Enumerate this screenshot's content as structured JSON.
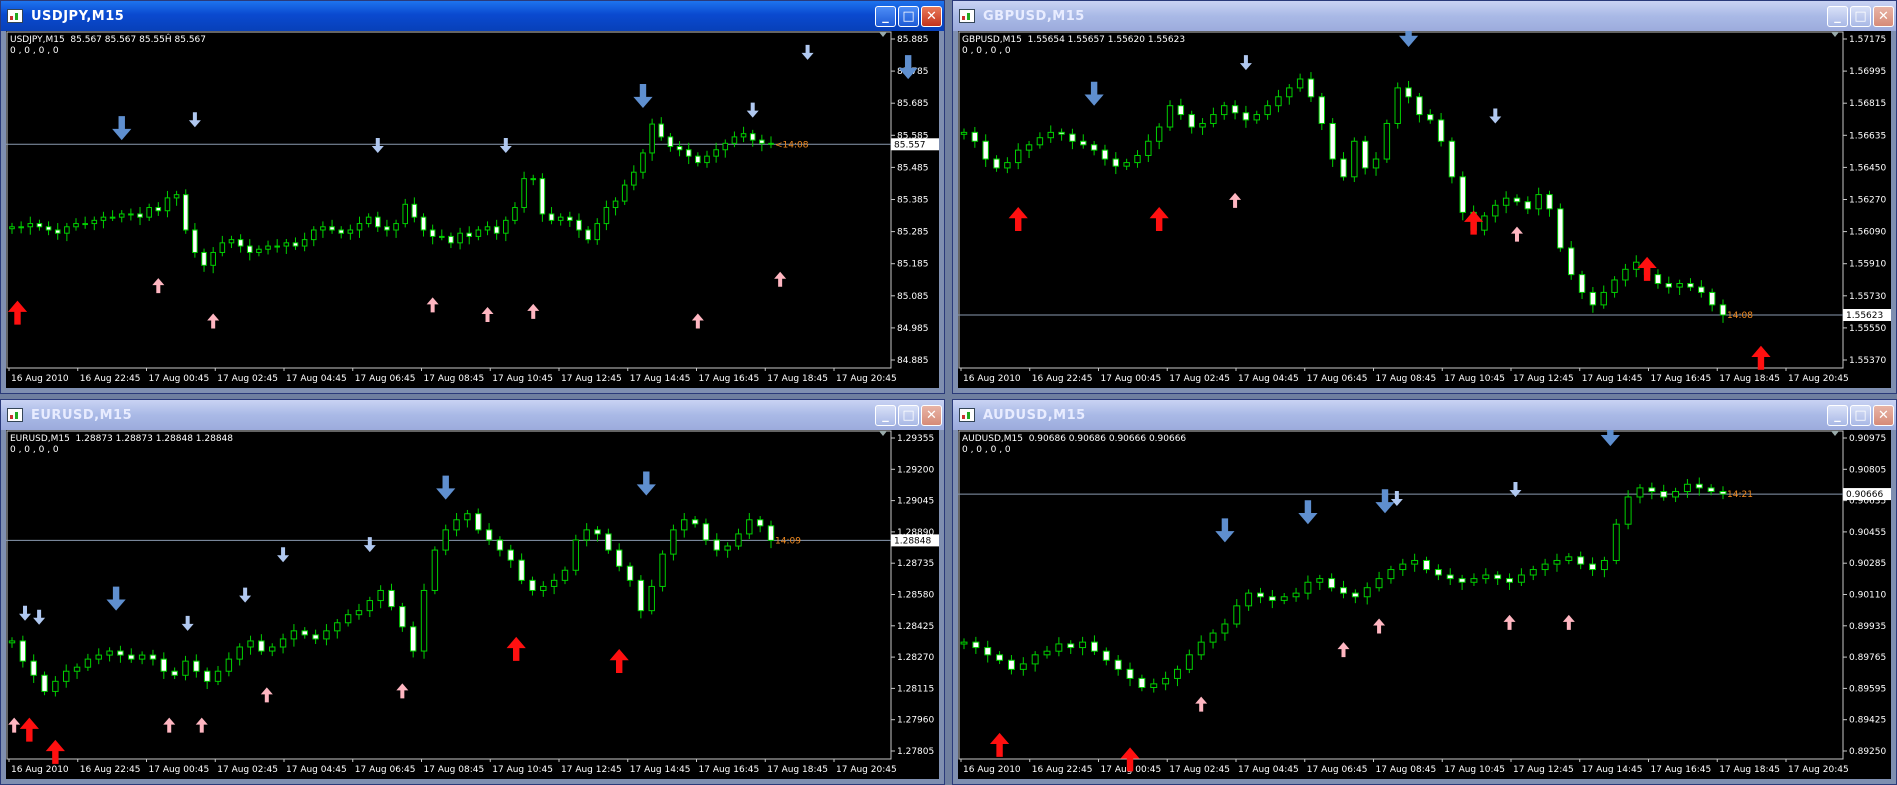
{
  "windows": [
    {
      "id": "usdjpy",
      "title": "USDJPY,M15",
      "active": true,
      "info_line": "USDJPY,M15  85.567 85.567 85.55Ĥ 85.567",
      "indicator_line": "0 , 0 , 0 , 0",
      "price_label": "85.557",
      "timer_label": "<14:08",
      "y_ticks": [
        "85.885",
        "85.785",
        "85.685",
        "85.585",
        "85.485",
        "85.385",
        "85.285",
        "85.185",
        "85.085",
        "84.985",
        "84.885"
      ],
      "x_ticks": [
        "16 Aug 2010",
        "16 Aug 22:45",
        "17 Aug 00:45",
        "17 Aug 02:45",
        "17 Aug 04:45",
        "17 Aug 06:45",
        "17 Aug 08:45",
        "17 Aug 10:45",
        "17 Aug 12:45",
        "17 Aug 14:45",
        "17 Aug 16:45",
        "17 Aug 18:45",
        "17 Aug 20:45"
      ],
      "ylim": [
        84.885,
        85.885
      ],
      "current_price": 85.557,
      "closes": [
        85.3,
        85.3,
        85.31,
        85.3,
        85.29,
        85.28,
        85.3,
        85.31,
        85.31,
        85.32,
        85.33,
        85.33,
        85.34,
        85.34,
        85.33,
        85.36,
        85.35,
        85.39,
        85.4,
        85.29,
        85.22,
        85.18,
        85.22,
        85.25,
        85.26,
        85.24,
        85.22,
        85.23,
        85.24,
        85.24,
        85.25,
        85.24,
        85.26,
        85.29,
        85.3,
        85.29,
        85.28,
        85.29,
        85.31,
        85.33,
        85.3,
        85.29,
        85.31,
        85.37,
        85.33,
        85.29,
        85.27,
        85.27,
        85.25,
        85.28,
        85.27,
        85.29,
        85.3,
        85.28,
        85.32,
        85.36,
        85.45,
        85.45,
        85.34,
        85.32,
        85.33,
        85.32,
        85.29,
        85.26,
        85.31,
        85.36,
        85.38,
        85.43,
        85.47,
        85.53,
        85.62,
        85.58,
        85.55,
        85.54,
        85.52,
        85.5,
        85.52,
        85.54,
        85.56,
        85.58,
        85.59,
        85.57,
        85.56,
        85.557
      ],
      "up_big": [
        [
          0.6,
          85.07
        ]
      ],
      "up_small": [
        [
          16,
          85.14
        ],
        [
          22,
          85.03
        ],
        [
          46,
          85.08
        ],
        [
          52,
          85.05
        ],
        [
          57,
          85.06
        ],
        [
          75,
          85.03
        ],
        [
          84,
          85.16
        ]
      ],
      "down_big": [
        [
          12,
          85.57
        ],
        [
          69,
          85.67
        ],
        [
          98,
          85.76
        ]
      ],
      "down_small": [
        [
          20,
          85.61
        ],
        [
          40,
          85.53
        ],
        [
          54,
          85.53
        ],
        [
          81,
          85.64
        ],
        [
          87,
          85.82
        ]
      ]
    },
    {
      "id": "gbpusd",
      "title": "GBPUSD,M15",
      "active": false,
      "info_line": "GBPUSD,M15  1.55654 1.55657 1.55620 1.55623",
      "indicator_line": "0 , 0 , 0 , 0",
      "price_label": "1.55623",
      "timer_label": "14:08",
      "y_ticks": [
        "1.57175",
        "1.56995",
        "1.56815",
        "1.56635",
        "1.56450",
        "1.56270",
        "1.56090",
        "1.55910",
        "1.55730",
        "1.55550",
        "1.55370"
      ],
      "x_ticks": [
        "16 Aug 2010",
        "16 Aug 22:45",
        "17 Aug 00:45",
        "17 Aug 02:45",
        "17 Aug 04:45",
        "17 Aug 06:45",
        "17 Aug 08:45",
        "17 Aug 10:45",
        "17 Aug 12:45",
        "17 Aug 14:45",
        "17 Aug 16:45",
        "17 Aug 18:45",
        "17 Aug 20:45"
      ],
      "ylim": [
        1.5537,
        1.57175
      ],
      "current_price": 1.55623,
      "closes": [
        1.5665,
        1.566,
        1.565,
        1.5645,
        1.5648,
        1.5655,
        1.5658,
        1.5662,
        1.5665,
        1.5664,
        1.566,
        1.5658,
        1.5655,
        1.565,
        1.5646,
        1.5648,
        1.5652,
        1.566,
        1.5668,
        1.568,
        1.5675,
        1.5668,
        1.567,
        1.5675,
        1.568,
        1.5676,
        1.5672,
        1.5675,
        1.568,
        1.5685,
        1.569,
        1.5695,
        1.5685,
        1.567,
        1.565,
        1.564,
        1.566,
        1.5645,
        1.565,
        1.567,
        1.569,
        1.5685,
        1.5675,
        1.5672,
        1.566,
        1.564,
        1.562,
        1.561,
        1.5618,
        1.5624,
        1.5628,
        1.5626,
        1.5622,
        1.563,
        1.5622,
        1.56,
        1.5585,
        1.5575,
        1.5568,
        1.5575,
        1.5582,
        1.5588,
        1.5592,
        1.5585,
        1.558,
        1.5578,
        1.558,
        1.5578,
        1.5575,
        1.5568,
        1.55623
      ],
      "up_big": [
        [
          5,
          1.5623
        ],
        [
          18,
          1.5623
        ],
        [
          47,
          1.5621
        ],
        [
          63,
          1.5595
        ],
        [
          73.5,
          1.5545
        ]
      ],
      "up_small": [
        [
          25,
          1.5631
        ],
        [
          51,
          1.5612
        ]
      ],
      "down_big": [
        [
          12,
          1.568
        ],
        [
          41,
          1.5713
        ]
      ],
      "down_small": [
        [
          26,
          1.57
        ],
        [
          49,
          1.567
        ]
      ]
    },
    {
      "id": "eurusd",
      "title": "EURUSD,M15",
      "active": false,
      "info_line": "EURUSD,M15  1.28873 1.28873 1.28848 1.28848",
      "indicator_line": "0 , 0 , 0 , 0",
      "price_label": "1.28848",
      "timer_label": "14:09",
      "y_ticks": [
        "1.29355",
        "1.29200",
        "1.29045",
        "1.28890",
        "1.28735",
        "1.28580",
        "1.28425",
        "1.28270",
        "1.28115",
        "1.27960",
        "1.27805"
      ],
      "x_ticks": [
        "16 Aug 2010",
        "16 Aug 22:45",
        "17 Aug 00:45",
        "17 Aug 02:45",
        "17 Aug 04:45",
        "17 Aug 06:45",
        "17 Aug 08:45",
        "17 Aug 10:45",
        "17 Aug 12:45",
        "17 Aug 14:45",
        "17 Aug 16:45",
        "17 Aug 18:45",
        "17 Aug 20:45"
      ],
      "ylim": [
        1.27805,
        1.29355
      ],
      "current_price": 1.28848,
      "closes": [
        1.2835,
        1.2825,
        1.2818,
        1.281,
        1.2815,
        1.282,
        1.2822,
        1.2826,
        1.2828,
        1.283,
        1.2828,
        1.2826,
        1.2828,
        1.2826,
        1.282,
        1.2818,
        1.2825,
        1.282,
        1.2815,
        1.282,
        1.2826,
        1.2832,
        1.2835,
        1.283,
        1.2832,
        1.2836,
        1.284,
        1.2838,
        1.2836,
        1.284,
        1.2844,
        1.2848,
        1.285,
        1.2855,
        1.286,
        1.2852,
        1.2842,
        1.283,
        1.286,
        1.288,
        1.289,
        1.2895,
        1.2898,
        1.289,
        1.2885,
        1.288,
        1.2875,
        1.2865,
        1.286,
        1.2862,
        1.2865,
        1.287,
        1.2885,
        1.289,
        1.2888,
        1.288,
        1.2872,
        1.2865,
        1.285,
        1.2862,
        1.2878,
        1.289,
        1.2895,
        1.2893,
        1.2885,
        1.288,
        1.2882,
        1.2888,
        1.2895,
        1.2892,
        1.28848
      ],
      "up_big": [
        [
          1.6,
          1.2797
        ],
        [
          4,
          1.2786
        ],
        [
          46.5,
          1.2837
        ],
        [
          56,
          1.2831
        ]
      ],
      "up_small": [
        [
          0.2,
          1.2797
        ],
        [
          14.5,
          1.2797
        ],
        [
          17.5,
          1.2797
        ],
        [
          23.5,
          1.2812
        ],
        [
          36,
          1.2814
        ]
      ],
      "down_big": [
        [
          9.6,
          1.285
        ],
        [
          40,
          1.2905
        ],
        [
          58.5,
          1.2907
        ]
      ],
      "down_small": [
        [
          1.2,
          1.2845
        ],
        [
          2.5,
          1.2843
        ],
        [
          16.2,
          1.284
        ],
        [
          21.5,
          1.2854
        ],
        [
          25,
          1.2874
        ],
        [
          33,
          1.2879
        ]
      ]
    },
    {
      "id": "audusd",
      "title": "AUDUSD,M15",
      "active": false,
      "info_line": "AUDUSD,M15  0.90686 0.90686 0.90666 0.90666",
      "indicator_line": "0 , 0 , 0 , 0",
      "price_label": "0.90666",
      "timer_label": "14:21",
      "y_ticks": [
        "0.90975",
        "0.90805",
        "0.90635",
        "0.90455",
        "0.90285",
        "0.90110",
        "0.89935",
        "0.89765",
        "0.89595",
        "0.89425",
        "0.89250"
      ],
      "x_ticks": [
        "16 Aug 2010",
        "16 Aug 22:45",
        "17 Aug 00:45",
        "17 Aug 02:45",
        "17 Aug 04:45",
        "17 Aug 06:45",
        "17 Aug 08:45",
        "17 Aug 10:45",
        "17 Aug 12:45",
        "17 Aug 14:45",
        "17 Aug 16:45",
        "17 Aug 18:45",
        "17 Aug 20:45"
      ],
      "ylim": [
        0.8925,
        0.90975
      ],
      "current_price": 0.90666,
      "closes": [
        0.8985,
        0.8982,
        0.8978,
        0.8975,
        0.897,
        0.8973,
        0.8978,
        0.898,
        0.8984,
        0.8982,
        0.8985,
        0.898,
        0.8975,
        0.897,
        0.8965,
        0.896,
        0.8962,
        0.8965,
        0.897,
        0.8978,
        0.8985,
        0.899,
        0.8995,
        0.9005,
        0.9012,
        0.901,
        0.9008,
        0.901,
        0.9012,
        0.9018,
        0.902,
        0.9015,
        0.9012,
        0.901,
        0.9015,
        0.902,
        0.9025,
        0.9028,
        0.903,
        0.9025,
        0.9022,
        0.902,
        0.9018,
        0.902,
        0.9022,
        0.902,
        0.9018,
        0.9022,
        0.9025,
        0.9028,
        0.903,
        0.9032,
        0.9028,
        0.9025,
        0.903,
        0.905,
        0.9065,
        0.907,
        0.9068,
        0.9065,
        0.9068,
        0.9072,
        0.907,
        0.9068,
        0.90666
      ],
      "up_big": [
        [
          3,
          0.8935
        ],
        [
          14,
          0.8927
        ]
      ],
      "up_small": [
        [
          20,
          0.8955
        ],
        [
          32,
          0.8985
        ],
        [
          35,
          0.8998
        ],
        [
          46,
          0.9
        ],
        [
          51,
          0.9
        ]
      ],
      "down_big": [
        [
          22,
          0.904
        ],
        [
          29,
          0.905
        ],
        [
          35.5,
          0.9056
        ],
        [
          54.5,
          0.9093
        ]
      ],
      "down_small": [
        [
          36.5,
          0.906
        ],
        [
          46.5,
          0.9065
        ]
      ]
    }
  ]
}
